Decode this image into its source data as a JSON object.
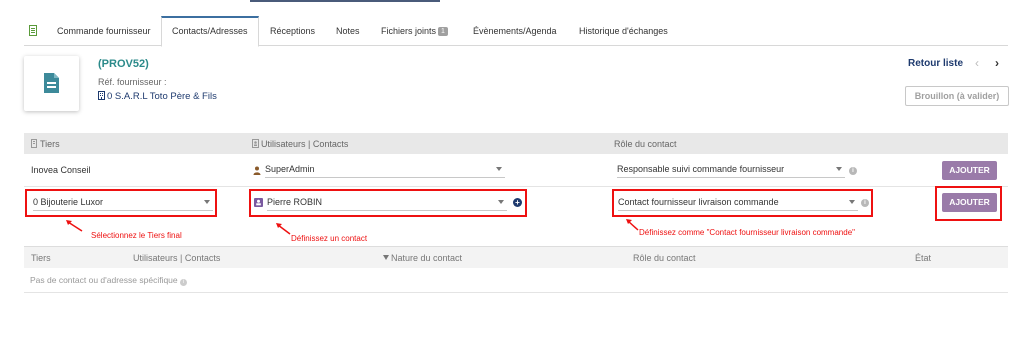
{
  "tabs": [
    {
      "label": "Commande fournisseur"
    },
    {
      "label": "Contacts/Adresses"
    },
    {
      "label": "Réceptions"
    },
    {
      "label": "Notes"
    },
    {
      "label": "Fichiers joints",
      "badge": "1"
    },
    {
      "label": "Évènements/Agenda"
    },
    {
      "label": "Historique d'échanges"
    }
  ],
  "header": {
    "ref": "(PROV52)",
    "ref_supplier_label": "Réf. fournisseur :",
    "supplier": "0 S.A.R.L Toto Père & Fils",
    "back_link": "Retour liste",
    "prev": "‹",
    "next": "›",
    "status": "Brouillon (à valider)"
  },
  "form": {
    "columns": {
      "tiers": "Tiers",
      "users_contacts": "Utilisateurs | Contacts",
      "role": "Rôle du contact"
    },
    "rows": [
      {
        "tiers": "Inovea Conseil",
        "contact": "SuperAdmin",
        "role": "Responsable suivi commande fournisseur",
        "button": "AJOUTER"
      },
      {
        "tiers": "0 Bijouterie Luxor",
        "contact": "Pierre ROBIN",
        "role": "Contact fournisseur livraison commande",
        "button": "AJOUTER"
      }
    ]
  },
  "annotations": {
    "tiers": "Sélectionnez le Tiers final",
    "contact": "Définissez un contact",
    "role": "Définissez comme \"Contact fournisseur livraison commande\""
  },
  "list": {
    "columns": {
      "tiers": "Tiers",
      "users_contacts": "Utilisateurs | Contacts",
      "nature": "Nature du contact",
      "role": "Rôle du contact",
      "state": "État"
    },
    "empty": "Pas de contact ou d'adresse spécifique"
  },
  "colors": {
    "accent_ref": "#2b8a8a",
    "link": "#1e3a6e",
    "button": "#9a7ba9",
    "annotation": "#ee1111"
  }
}
